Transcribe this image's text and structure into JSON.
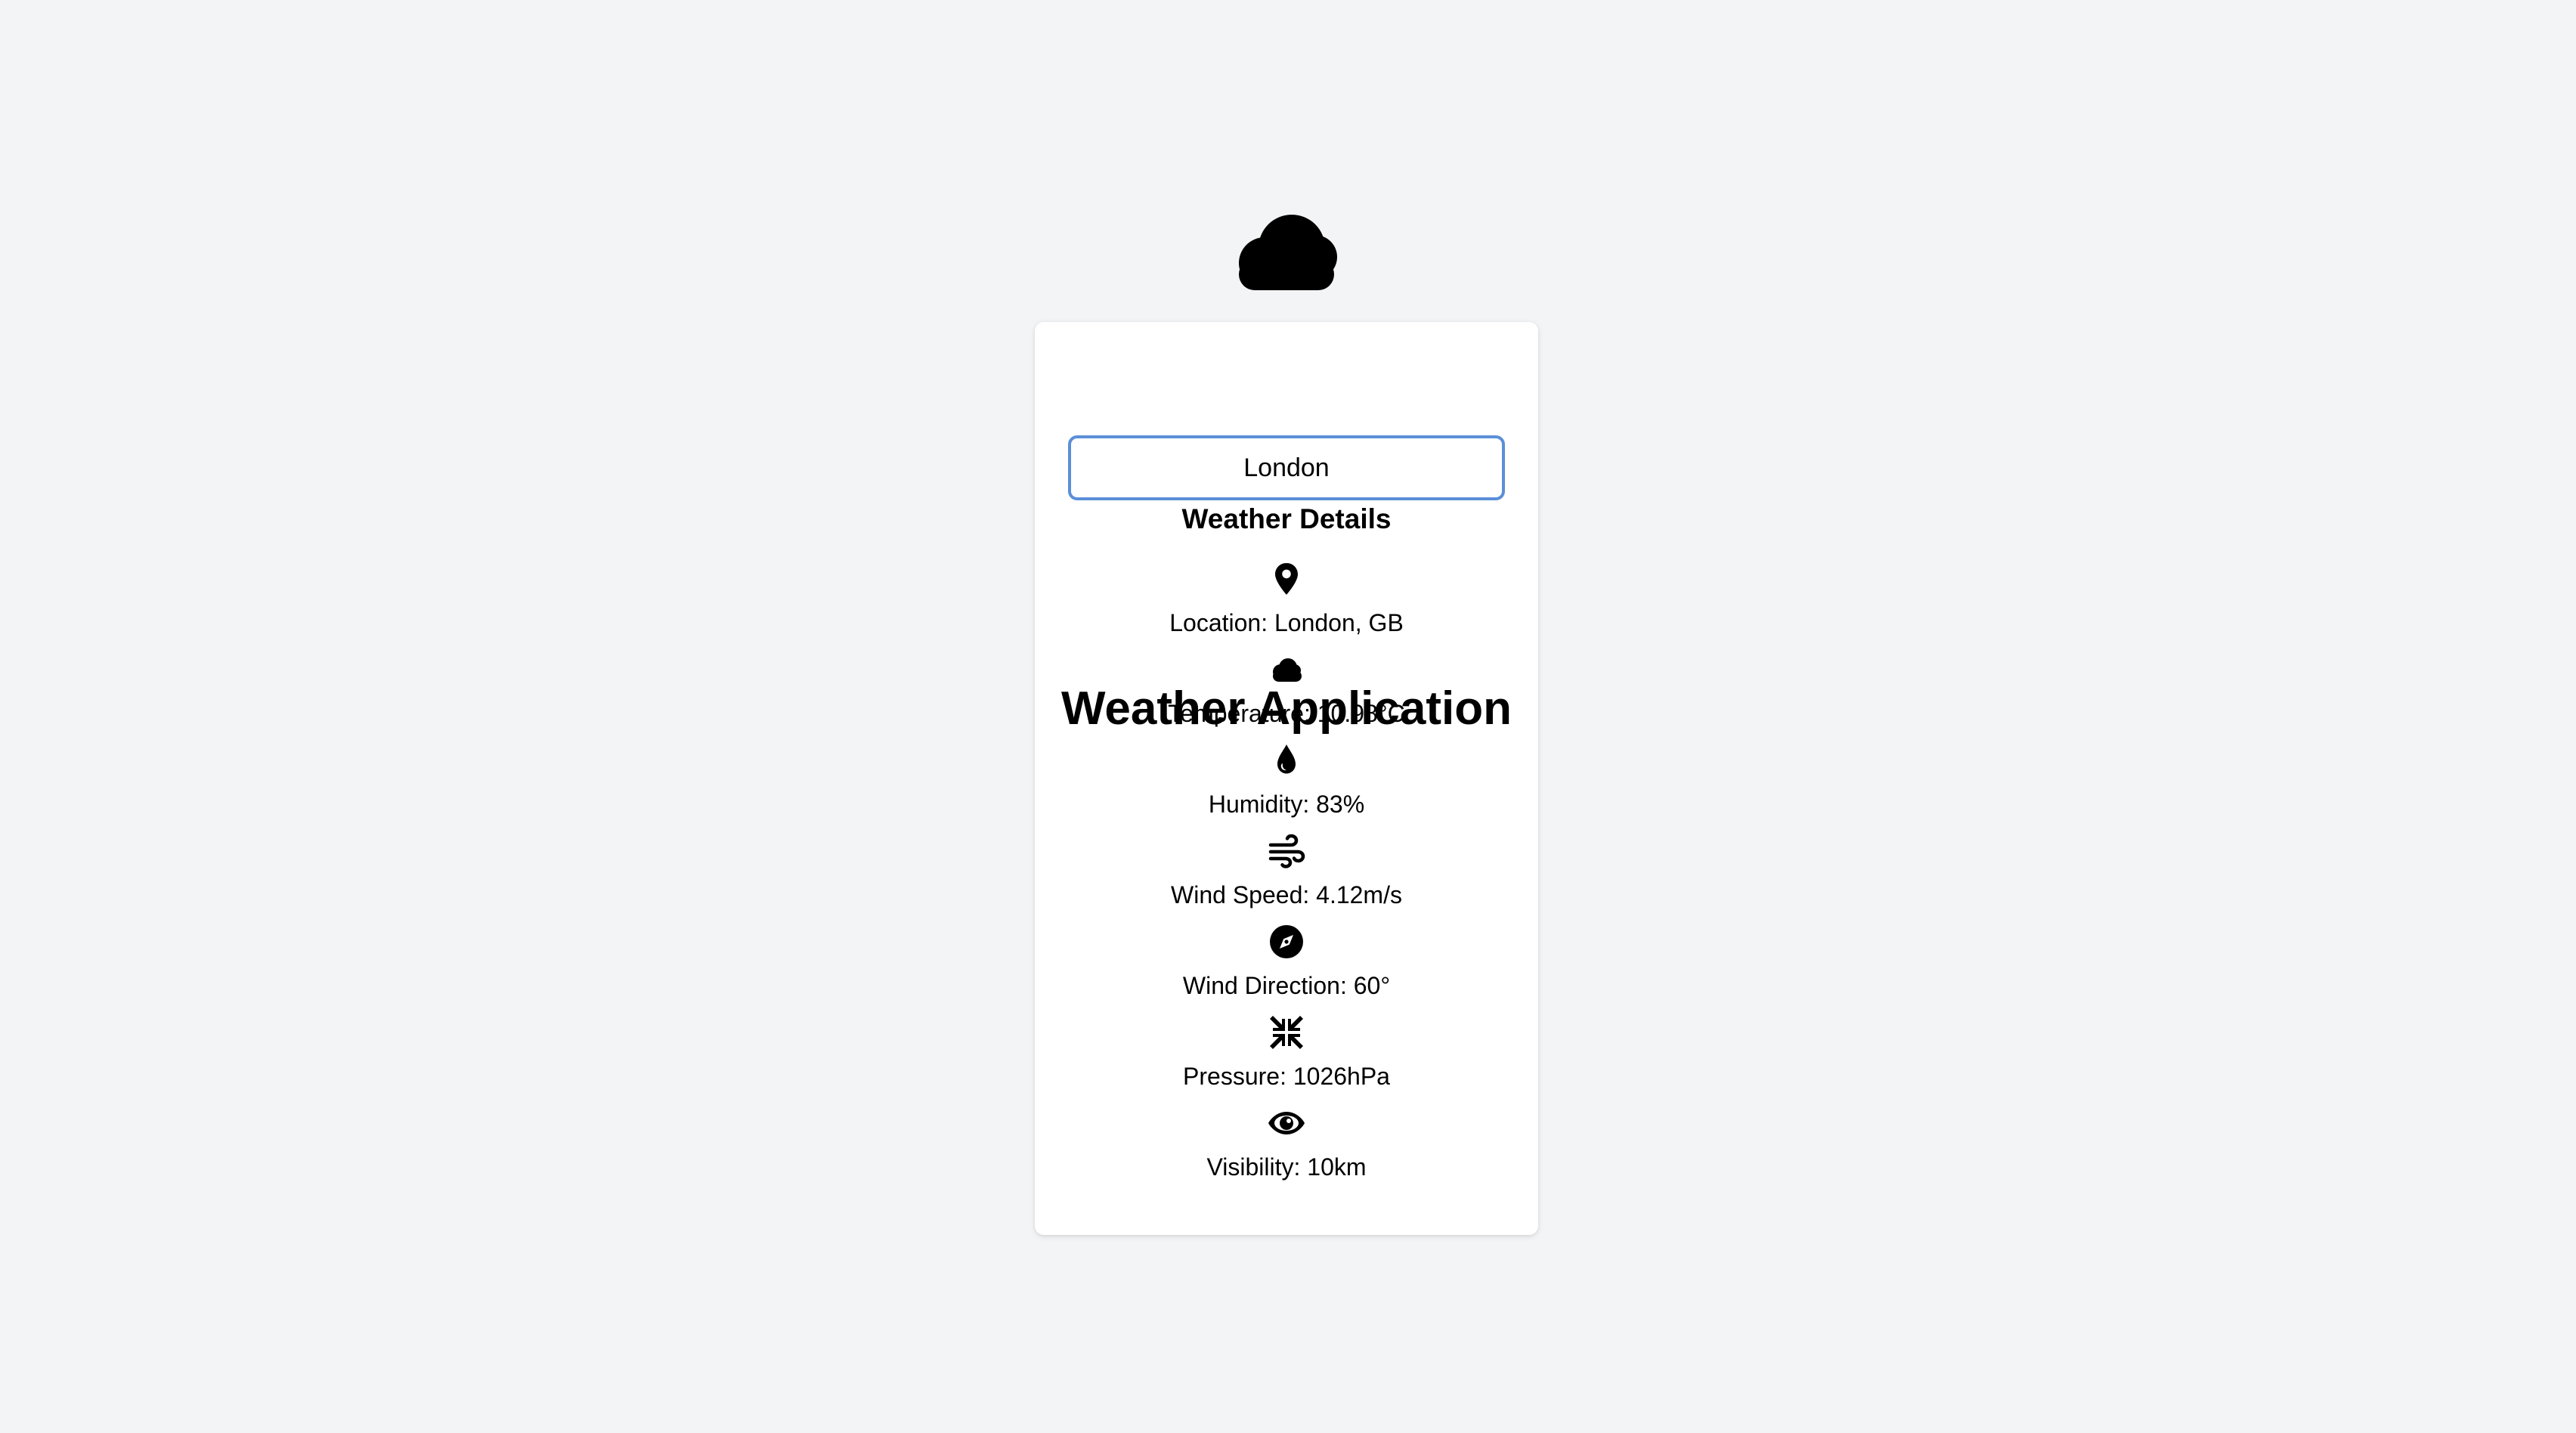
{
  "app": {
    "title": "Weather Application",
    "hero_icon": "cloud-icon"
  },
  "search": {
    "value": "London",
    "placeholder": ""
  },
  "details": {
    "title": "Weather Details",
    "items": [
      {
        "icon": "location-pin-icon",
        "text": "Location: London, GB"
      },
      {
        "icon": "cloud-icon",
        "text": "Temperature: 10.98°C"
      },
      {
        "icon": "water-drop-icon",
        "text": "Humidity: 83%"
      },
      {
        "icon": "wind-icon",
        "text": "Wind Speed: 4.12m/s"
      },
      {
        "icon": "compass-icon",
        "text": "Wind Direction: 60°"
      },
      {
        "icon": "compress-arrows-icon",
        "text": "Pressure: 1026hPa"
      },
      {
        "icon": "eye-icon",
        "text": "Visibility: 10km"
      }
    ]
  },
  "colors": {
    "page_background": "#f3f4f6",
    "card_background": "#ffffff",
    "input_border": "#5b8fd8",
    "text": "#000000"
  }
}
